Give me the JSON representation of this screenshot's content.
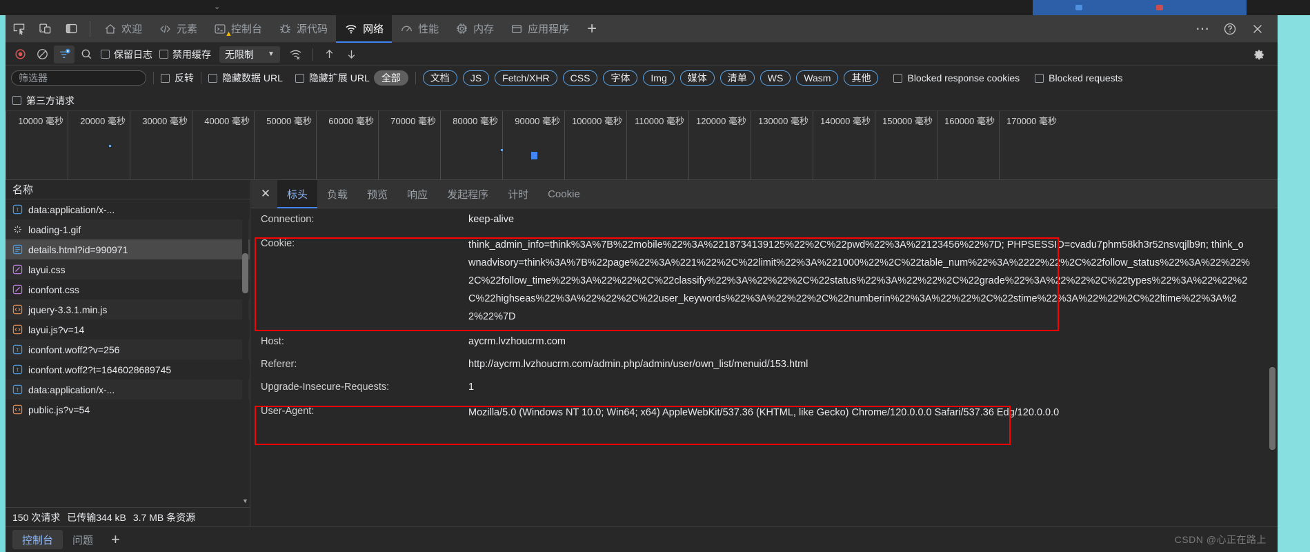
{
  "browser": {
    "tab_caret": "⌄"
  },
  "devtools": {
    "left_tools": [
      {
        "name": "inspect-element-icon",
        "label": ""
      },
      {
        "name": "device-toolbar-icon",
        "label": ""
      },
      {
        "name": "dock-side-icon",
        "label": ""
      }
    ],
    "tabs": [
      {
        "id": "welcome",
        "label": "欢迎",
        "icon": "home-icon",
        "selected": false
      },
      {
        "id": "elements",
        "label": "元素",
        "icon": "code-brackets-icon",
        "selected": false
      },
      {
        "id": "console",
        "label": "控制台",
        "icon": "console-prompt-icon",
        "selected": false,
        "warning": true
      },
      {
        "id": "sources",
        "label": "源代码",
        "icon": "bug-icon",
        "selected": false
      },
      {
        "id": "network",
        "label": "网络",
        "icon": "wifi-icon",
        "selected": true
      },
      {
        "id": "performance",
        "label": "性能",
        "icon": "gauge-icon",
        "selected": false
      },
      {
        "id": "memory",
        "label": "内存",
        "icon": "chip-icon",
        "selected": false
      },
      {
        "id": "application",
        "label": "应用程序",
        "icon": "window-icon",
        "selected": false
      }
    ],
    "add_tab_label": "+",
    "more_label": "⋯",
    "help_label": "?",
    "close_label": "✕"
  },
  "network_toolbar": {
    "record_title": "record-button",
    "clear_title": "clear-button",
    "filter_toggle_title": "filter-toggle-button",
    "search_title": "search-button",
    "preserve_log": "保留日志",
    "disable_cache": "禁用缓存",
    "throttling": "无限制",
    "throttle_caret": "▼",
    "import_har_title": "import-har-button",
    "export_har_title": "export-har-button",
    "settings_title": "settings-gear-button"
  },
  "filter_bar": {
    "filter_placeholder": "筛选器",
    "filter_value": "",
    "invert": "反转",
    "hide_data_urls": "隐藏数据 URL",
    "hide_extension_urls": "隐藏扩展 URL",
    "chips": [
      {
        "label": "全部",
        "active": true
      },
      {
        "label": "文档",
        "active": false
      },
      {
        "label": "JS",
        "active": false
      },
      {
        "label": "Fetch/XHR",
        "active": false
      },
      {
        "label": "CSS",
        "active": false
      },
      {
        "label": "字体",
        "active": false
      },
      {
        "label": "Img",
        "active": false
      },
      {
        "label": "媒体",
        "active": false
      },
      {
        "label": "清单",
        "active": false
      },
      {
        "label": "WS",
        "active": false
      },
      {
        "label": "Wasm",
        "active": false
      },
      {
        "label": "其他",
        "active": false
      }
    ],
    "blocked_response_cookies": "Blocked response cookies",
    "blocked_requests": "Blocked requests",
    "third_party_requests": "第三方请求"
  },
  "overview": {
    "unit": "毫秒",
    "ticks": [
      "10000 毫秒",
      "20000 毫秒",
      "30000 毫秒",
      "40000 毫秒",
      "50000 毫秒",
      "60000 毫秒",
      "70000 毫秒",
      "80000 毫秒",
      "90000 毫秒",
      "100000 毫秒",
      "110000 毫秒",
      "120000 毫秒",
      "130000 毫秒",
      "140000 毫秒",
      "150000 毫秒",
      "160000 毫秒",
      "170000 毫秒"
    ]
  },
  "request_list": {
    "column_header": "名称",
    "rows": [
      {
        "name": "data:application/x-...",
        "type": "font",
        "selected": false
      },
      {
        "name": "loading-1.gif",
        "type": "image",
        "selected": false
      },
      {
        "name": "details.html?id=990971",
        "type": "document",
        "selected": true
      },
      {
        "name": "layui.css",
        "type": "stylesheet",
        "selected": false
      },
      {
        "name": "iconfont.css",
        "type": "stylesheet",
        "selected": false
      },
      {
        "name": "jquery-3.3.1.min.js",
        "type": "script",
        "selected": false
      },
      {
        "name": "layui.js?v=14",
        "type": "script",
        "selected": false
      },
      {
        "name": "iconfont.woff2?v=256",
        "type": "font",
        "selected": false
      },
      {
        "name": "iconfont.woff2?t=1646028689745",
        "type": "font",
        "selected": false
      },
      {
        "name": "data:application/x-...",
        "type": "font",
        "selected": false
      },
      {
        "name": "public.js?v=54",
        "type": "script",
        "selected": false
      }
    ],
    "status": {
      "requests": "150 次请求",
      "transferred": "已传输344 kB",
      "resources": "3.7 MB 条资源"
    }
  },
  "detail": {
    "close_label": "✕",
    "tabs": [
      {
        "label": "标头",
        "selected": true
      },
      {
        "label": "负载",
        "selected": false
      },
      {
        "label": "预览",
        "selected": false
      },
      {
        "label": "响应",
        "selected": false
      },
      {
        "label": "发起程序",
        "selected": false
      },
      {
        "label": "计时",
        "selected": false
      },
      {
        "label": "Cookie",
        "selected": false
      }
    ],
    "headers": [
      {
        "name": "Connection:",
        "value": "keep-alive",
        "highlighted": false
      },
      {
        "name": "Cookie:",
        "value": "think_admin_info=think%3A%7B%22mobile%22%3A%2218734139125%22%2C%22pwd%22%3A%22123456%22%7D; PHPSESSID=cvadu7phm58kh3r52nsvqjlb9n; think_ownadvisory=think%3A%7B%22page%22%3A%221%22%2C%22limit%22%3A%221000%22%2C%22table_num%22%3A%2222%22%2C%22follow_status%22%3A%22%22%2C%22follow_time%22%3A%22%22%2C%22classify%22%3A%22%22%2C%22status%22%3A%22%22%2C%22grade%22%3A%22%22%2C%22types%22%3A%22%22%2C%22highseas%22%3A%22%22%2C%22user_keywords%22%3A%22%22%2C%22numberin%22%3A%22%22%2C%22stime%22%3A%22%22%2C%22ltime%22%3A%22%22%7D",
        "highlighted": true
      },
      {
        "name": "Host:",
        "value": "aycrm.lvzhoucrm.com",
        "highlighted": false
      },
      {
        "name": "Referer:",
        "value": "http://aycrm.lvzhoucrm.com/admin.php/admin/user/own_list/menuid/153.html",
        "highlighted": false
      },
      {
        "name": "Upgrade-Insecure-Requests:",
        "value": "1",
        "highlighted": false
      },
      {
        "name": "User-Agent:",
        "value": "Mozilla/5.0 (Windows NT 10.0; Win64; x64) AppleWebKit/537.36 (KHTML, like Gecko) Chrome/120.0.0.0 Safari/537.36 Edg/120.0.0.0",
        "highlighted": true
      }
    ]
  },
  "drawer": {
    "tabs": [
      {
        "label": "控制台",
        "selected": true
      },
      {
        "label": "问题",
        "selected": false
      }
    ],
    "plus_label": "+",
    "watermark": "CSDN @心正在路上"
  },
  "colors": {
    "accent_blue": "#4285f4",
    "chip_border": "#5aa5e8",
    "highlight_red": "#ff0000",
    "link_blue": "#8ab4f8",
    "cyan_rail": "#77dcdc"
  }
}
